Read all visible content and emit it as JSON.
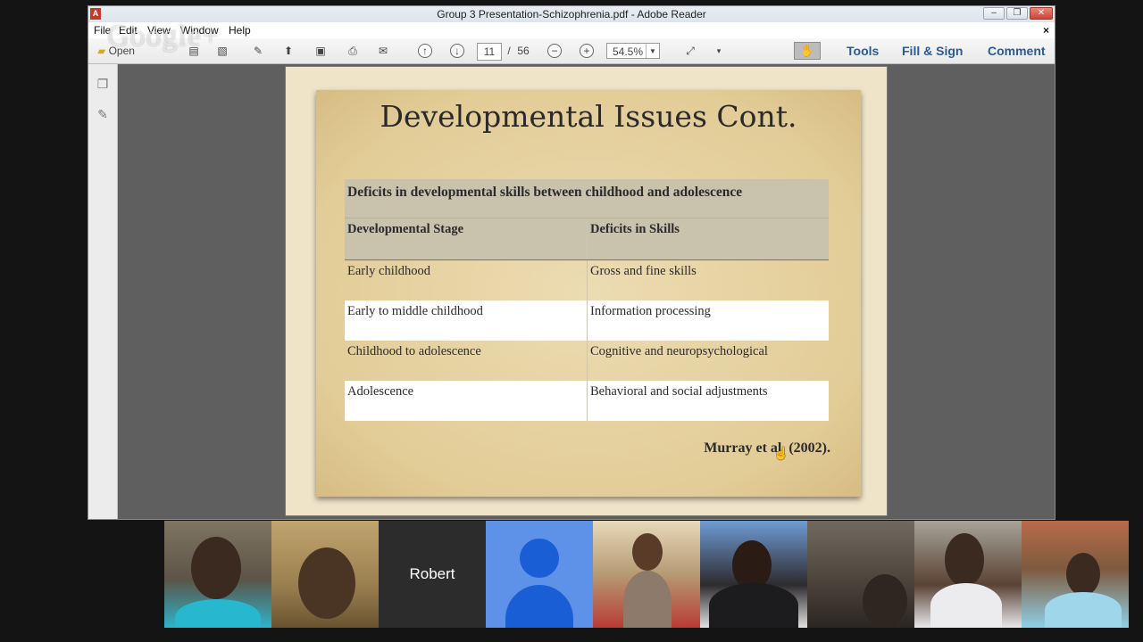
{
  "window": {
    "title": "Group 3 Presentation-Schizophrenia.pdf - Adobe Reader",
    "controls": [
      "–",
      "❐",
      "✕"
    ]
  },
  "menu": {
    "items": [
      "File",
      "Edit",
      "View",
      "Window",
      "Help"
    ],
    "close": "×"
  },
  "toolbar": {
    "open_label": "Open",
    "page_current": "11",
    "page_separator": "/",
    "page_total": "56",
    "zoom": "54.5%",
    "tools_label": "Tools",
    "fill_sign_label": "Fill & Sign",
    "comment_label": "Comment"
  },
  "watermark": "Google+",
  "slide": {
    "title": "Developmental Issues Cont.",
    "table_title": "Deficits in developmental skills between childhood and adolescence",
    "col_headers": [
      "Developmental Stage",
      "Deficits in Skills"
    ],
    "rows": [
      [
        "Early childhood",
        "Gross and fine skills"
      ],
      [
        "Early to middle childhood",
        "Information processing"
      ],
      [
        "Childhood to adolescence",
        "Cognitive and neuropsychological"
      ],
      [
        "Adolescence",
        "Behavioral and social adjustments"
      ]
    ],
    "citation": "Murray et al. (2002)."
  },
  "participants": [
    {
      "name": ""
    },
    {
      "name": ""
    },
    {
      "name": "Robert"
    },
    {
      "name": ""
    },
    {
      "name": ""
    },
    {
      "name": ""
    },
    {
      "name": ""
    },
    {
      "name": ""
    },
    {
      "name": ""
    }
  ]
}
